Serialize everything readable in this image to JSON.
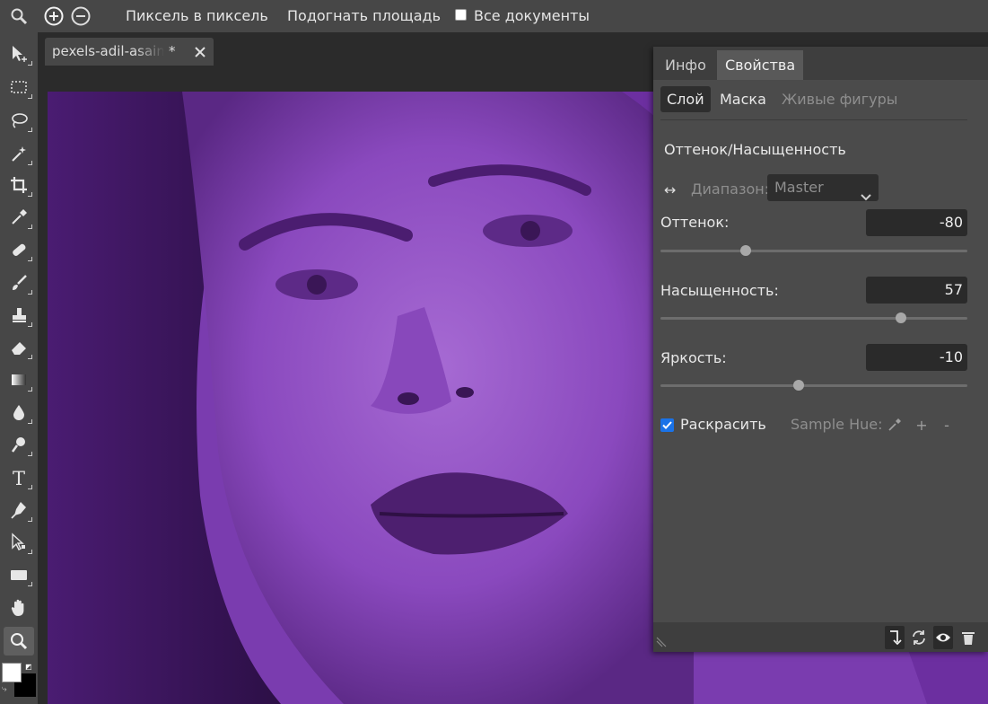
{
  "topbar": {
    "pixel_label": "Пиксель в пиксель",
    "fit_label": "Подогнать площадь",
    "all_docs_label": "Все документы"
  },
  "document": {
    "tab_name": "pexels-adil-asain",
    "modified_mark": "*"
  },
  "panel": {
    "tabs": [
      "Инфо",
      "Свойства"
    ],
    "subtabs": [
      "Слой",
      "Маска",
      "Живые фигуры"
    ],
    "title": "Оттенок/Насыщенность",
    "range_label": "Диапазон:",
    "range_value": "Master",
    "hue": {
      "label": "Оттенок:",
      "value": "-80",
      "min": -180,
      "max": 180
    },
    "saturation": {
      "label": "Насыщенность:",
      "value": "57",
      "min": -100,
      "max": 100
    },
    "lightness": {
      "label": "Яркость:",
      "value": "-10",
      "min": -100,
      "max": 100
    },
    "colorize_label": "Раскрасить",
    "colorize_checked": true,
    "sample_hue_label": "Sample Hue:",
    "plus": "+",
    "minus": "-"
  },
  "colors": {
    "foreground": "#ffffff",
    "background": "#000000",
    "tint": "#7e3fb3",
    "checkbox": "#1a73e8"
  }
}
